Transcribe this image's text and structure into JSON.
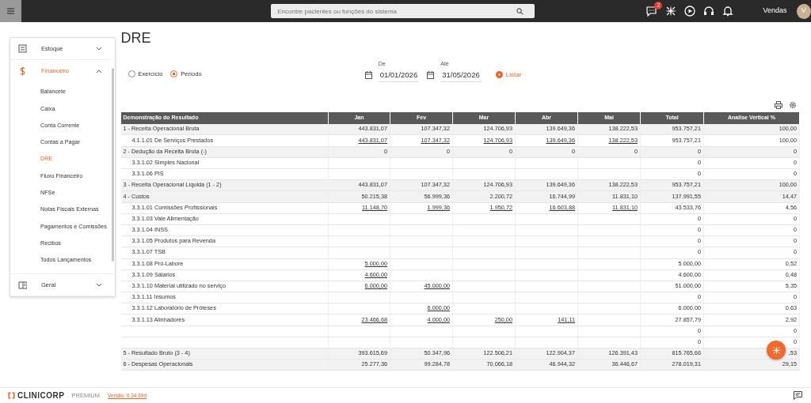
{
  "topbar": {
    "search": {
      "placeholder": "Encontre pacientes ou funções do sistema"
    },
    "notification_badge": "2",
    "user": {
      "name": "Vendas",
      "initial": "V"
    }
  },
  "sidebar": {
    "sections": [
      {
        "label": "Estoque",
        "expanded": false
      },
      {
        "label": "Financeiro",
        "expanded": true,
        "children": [
          {
            "label": "Balancete",
            "selected": false
          },
          {
            "label": "Caixa",
            "selected": false
          },
          {
            "label": "Conta Corrente",
            "selected": false
          },
          {
            "label": "Contas a Pagar",
            "selected": false
          },
          {
            "label": "DRE",
            "selected": true
          },
          {
            "label": "Fluxo Financeiro",
            "selected": false
          },
          {
            "label": "NFSe",
            "selected": false
          },
          {
            "label": "Notas Fiscais Externas",
            "selected": false
          },
          {
            "label": "Pagamentos e Comissões",
            "selected": false
          },
          {
            "label": "Recibos",
            "selected": false
          },
          {
            "label": "Todos Lançamentos",
            "selected": false
          }
        ]
      },
      {
        "label": "Geral",
        "expanded": false
      }
    ]
  },
  "page": {
    "title": "DRE"
  },
  "filters": {
    "modes": [
      {
        "label": "Exercício",
        "selected": false
      },
      {
        "label": "Período",
        "selected": true
      }
    ],
    "from": {
      "label": "De",
      "value": "01/01/2026"
    },
    "to": {
      "label": "Até",
      "value": "31/05/2026"
    },
    "submit": "Listar"
  },
  "table": {
    "columns": [
      "Demonstração do Resultado",
      "Jan",
      "Fev",
      "Mar",
      "Abr",
      "Mai",
      "Total",
      "Analise Vertical %"
    ],
    "rows": [
      {
        "kind": "group",
        "label": "1 - Receita Operacional Bruta",
        "months": {
          "jan": "443.831,07",
          "fev": "107.347,32",
          "mar": "124.706,93",
          "abr": "139.649,36",
          "mai": "138.222,53"
        },
        "total": "953.757,21",
        "vertical": "100,00"
      },
      {
        "kind": "item",
        "label": "4.1.1.01 De Serviços Prestados",
        "months": {
          "jan": "443.831,07",
          "fev": "107.347,32",
          "mar": "124.706,93",
          "abr": "139.649,36",
          "mai": "138.222,53"
        },
        "total": "953.757,21",
        "vertical": "100,00"
      },
      {
        "kind": "group",
        "label": "2 - Dedução da Receita Bruta (-)",
        "months": {
          "jan": "0",
          "fev": "0",
          "mar": "0",
          "abr": "0",
          "mai": "0"
        },
        "total": "0",
        "vertical": "0"
      },
      {
        "kind": "item",
        "label": "3.3.1.02 Simples Nacional",
        "total": "0",
        "vertical": "0"
      },
      {
        "kind": "item",
        "label": "3.3.1.06 PIS",
        "total": "0",
        "vertical": "0"
      },
      {
        "kind": "group",
        "label": "3 - Receita Operacional Líquida (1 - 2)",
        "months": {
          "jan": "443.831,07",
          "fev": "107.347,32",
          "mar": "124.706,93",
          "abr": "139.649,36",
          "mai": "138.222,53"
        },
        "total": "953.757,21",
        "vertical": "100,00"
      },
      {
        "kind": "group",
        "label": "4 - Custos",
        "months": {
          "jan": "50.215,38",
          "fev": "56.999,36",
          "mar": "2.200,72",
          "abr": "16.744,99",
          "mai": "11.831,10"
        },
        "total": "137.991,55",
        "vertical": "14,47"
      },
      {
        "kind": "item",
        "label": "3.3.1.01 Comissões Profissionais",
        "months": {
          "jan": "11.148,70",
          "fev": "1.999,36",
          "mar": "1.950,72",
          "abr": "16.603,88",
          "mai": "11.831,10"
        },
        "total": "43.533,76",
        "vertical": "4,56"
      },
      {
        "kind": "item",
        "label": "3.3.1.03 Vale Alimentação",
        "total": "0",
        "vertical": "0"
      },
      {
        "kind": "item",
        "label": "3.3.1.04 INSS",
        "total": "0",
        "vertical": "0"
      },
      {
        "kind": "item",
        "label": "3.3.1.05 Produtos para Revenda",
        "total": "0",
        "vertical": "0"
      },
      {
        "kind": "item",
        "label": "3.3.1.07 TSB",
        "total": "0",
        "vertical": "0"
      },
      {
        "kind": "item",
        "label": "3.3.1.08 Pró-Labore",
        "months": {
          "jan": "5.000,00"
        },
        "total": "5.000,00",
        "vertical": "0,52"
      },
      {
        "kind": "item",
        "label": "3.3.1.09 Sálarios",
        "months": {
          "jan": "4.600,00"
        },
        "total": "4.600,00",
        "vertical": "0,48"
      },
      {
        "kind": "item",
        "label": "3.3.1.10 Material utilizado no serviço",
        "months": {
          "jan": "6.000,00",
          "fev": "45.000,00"
        },
        "total": "51.000,00",
        "vertical": "5,35"
      },
      {
        "kind": "item",
        "label": "3.3.1.11 Insumos",
        "total": "0",
        "vertical": "0"
      },
      {
        "kind": "item",
        "label": "3.3.1.12 Laboratório de Próteses",
        "months": {
          "fev": "6.000,00"
        },
        "total": "6.000,00",
        "vertical": "0,63"
      },
      {
        "kind": "item",
        "label": "3.3.1.13 Alinhadores",
        "months": {
          "jan": "23.466,68",
          "fev": "4.000,00",
          "mar": "250,00",
          "abr": "141,11"
        },
        "total": "27.857,79",
        "vertical": "2,92"
      },
      {
        "kind": "item",
        "total": "0",
        "vertical": "0"
      },
      {
        "kind": "item",
        "total": "0",
        "vertical": "0"
      },
      {
        "kind": "group",
        "label": "5 - Resultado Bruto (3 - 4)",
        "months": {
          "jan": "393.615,69",
          "fev": "50.347,96",
          "mar": "122.506,21",
          "abr": "122.904,37",
          "mai": "126.391,43"
        },
        "total": "815.765,66",
        "vertical": ",53"
      },
      {
        "kind": "group",
        "label": "6 - Despesas Operacionais",
        "months": {
          "jan": "25.277,36",
          "fev": "99.284,78",
          "mar": "70.066,18",
          "abr": "46.944,32",
          "mai": "36.446,67"
        },
        "total": "278.019,31",
        "vertical": "29,15"
      }
    ]
  },
  "footer": {
    "brand": "CLINICORP",
    "plan": "PREMIUM",
    "version": "Versão: 0.34.69d"
  }
}
